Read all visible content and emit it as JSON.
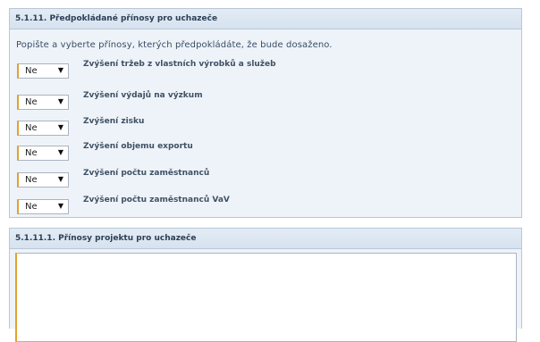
{
  "section1": {
    "title": "5.1.11. Předpokládané přínosy pro uchazeče",
    "description": "Popište a vyberte přínosy, kterých předpokládáte, že bude dosaženo.",
    "rows": [
      {
        "select_value": "Ne",
        "label": "Zvýšení tržeb z vlastních výrobků a služeb"
      },
      {
        "select_value": "Ne",
        "label": "Zvýšení výdajů na výzkum"
      },
      {
        "select_value": "Ne",
        "label": "Zvýšení zisku"
      },
      {
        "select_value": "Ne",
        "label": "Zvýšení objemu exportu"
      },
      {
        "select_value": "Ne",
        "label": "Zvýšení počtu zaměstnanců"
      },
      {
        "select_value": "Ne",
        "label": "Zvýšení počtu zaměstnanců VaV"
      }
    ]
  },
  "section2": {
    "title": "5.1.11.1. Přínosy projektu pro uchazeče",
    "textarea_value": ""
  },
  "icons": {
    "dropdown": "dropdown-arrow-icon"
  },
  "colors": {
    "required_marker": "#e3a12f",
    "panel_bg": "#eef3f9",
    "header_bg": "#d6e2ef"
  }
}
